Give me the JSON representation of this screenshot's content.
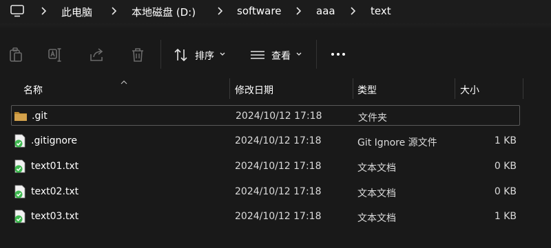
{
  "breadcrumbs": [
    {
      "label": "此电脑"
    },
    {
      "label": "本地磁盘 (D:)"
    },
    {
      "label": "software"
    },
    {
      "label": "aaa"
    },
    {
      "label": "text"
    }
  ],
  "toolbar": {
    "copy_icon": "copy-icon",
    "rename_icon": "rename-icon",
    "share_icon": "share-icon",
    "delete_icon": "delete-icon",
    "sort_label": "排序",
    "view_label": "查看",
    "more_label": "more-icon"
  },
  "columns": {
    "name": "名称",
    "modified": "修改日期",
    "type": "类型",
    "size": "大小"
  },
  "files": [
    {
      "name": ".git",
      "modified": "2024/10/12 17:18",
      "type": "文件夹",
      "size": "",
      "icon": "folder-icon",
      "selected": true
    },
    {
      "name": ".gitignore",
      "modified": "2024/10/12 17:18",
      "type": "Git Ignore 源文件",
      "size": "1 KB",
      "icon": "git-file-icon",
      "selected": false
    },
    {
      "name": "text01.txt",
      "modified": "2024/10/12 17:18",
      "type": "文本文档",
      "size": "0 KB",
      "icon": "git-file-icon",
      "selected": false
    },
    {
      "name": "text02.txt",
      "modified": "2024/10/12 17:18",
      "type": "文本文档",
      "size": "0 KB",
      "icon": "git-file-icon",
      "selected": false
    },
    {
      "name": "text03.txt",
      "modified": "2024/10/12 17:18",
      "type": "文本文档",
      "size": "1 KB",
      "icon": "git-file-icon",
      "selected": false
    }
  ],
  "colors": {
    "background": "#191919",
    "folder": "#d4a24c",
    "git_check": "#3fb950"
  }
}
